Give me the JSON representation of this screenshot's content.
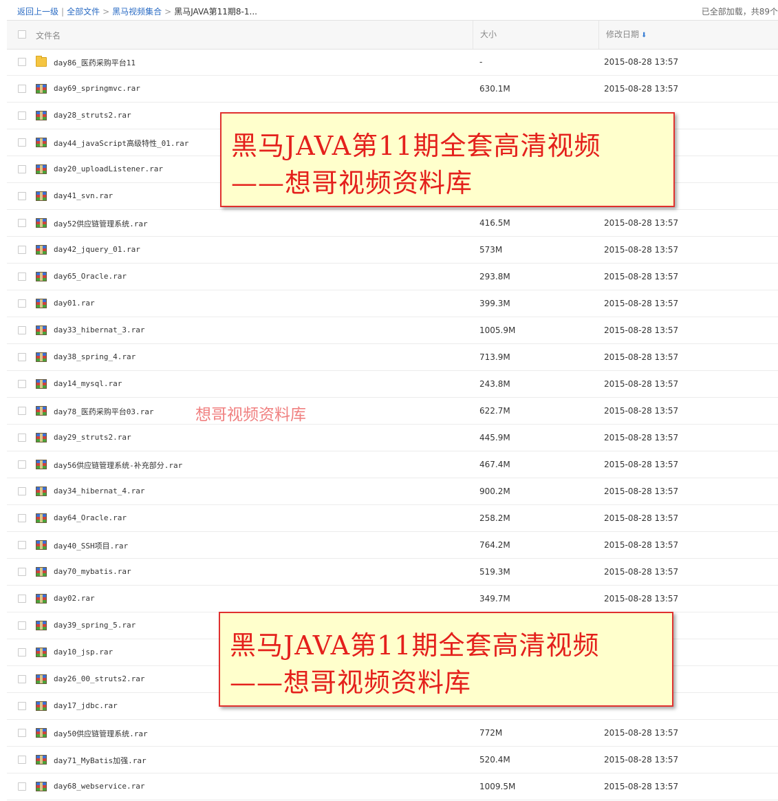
{
  "breadcrumb": {
    "back": "返回上一级",
    "sep1": "|",
    "all_files": "全部文件",
    "sep2": ">",
    "folder": "黑马视频集合",
    "sep3": ">",
    "current": "黑马JAVA第11期8-1..."
  },
  "status": "已全部加载，共89个",
  "header": {
    "name": "文件名",
    "size": "大小",
    "date": "修改日期",
    "sort_icon": "arrow-down-icon"
  },
  "files": [
    {
      "icon": "folder",
      "name": "day86_医药采购平台11",
      "size": "-",
      "date": "2015-08-28 13:57"
    },
    {
      "icon": "rar",
      "name": "day69_springmvc.rar",
      "size": "630.1M",
      "date": "2015-08-28 13:57"
    },
    {
      "icon": "rar",
      "name": "day28_struts2.rar",
      "size": "",
      "date": ""
    },
    {
      "icon": "rar",
      "name": "day44_javaScript高级特性_01.rar",
      "size": "",
      "date": ""
    },
    {
      "icon": "rar",
      "name": "day20_uploadListener.rar",
      "size": "",
      "date": ""
    },
    {
      "icon": "rar",
      "name": "day41_svn.rar",
      "size": "",
      "date": ""
    },
    {
      "icon": "rar",
      "name": "day52供应链管理系统.rar",
      "size": "416.5M",
      "date": "2015-08-28 13:57"
    },
    {
      "icon": "rar",
      "name": "day42_jquery_01.rar",
      "size": "573M",
      "date": "2015-08-28 13:57"
    },
    {
      "icon": "rar",
      "name": "day65_Oracle.rar",
      "size": "293.8M",
      "date": "2015-08-28 13:57"
    },
    {
      "icon": "rar",
      "name": "day01.rar",
      "size": "399.3M",
      "date": "2015-08-28 13:57"
    },
    {
      "icon": "rar",
      "name": "day33_hibernat_3.rar",
      "size": "1005.9M",
      "date": "2015-08-28 13:57"
    },
    {
      "icon": "rar",
      "name": "day38_spring_4.rar",
      "size": "713.9M",
      "date": "2015-08-28 13:57"
    },
    {
      "icon": "rar",
      "name": "day14_mysql.rar",
      "size": "243.8M",
      "date": "2015-08-28 13:57"
    },
    {
      "icon": "rar",
      "name": "day78_医药采购平台03.rar",
      "size": "622.7M",
      "date": "2015-08-28 13:57"
    },
    {
      "icon": "rar",
      "name": "day29_struts2.rar",
      "size": "445.9M",
      "date": "2015-08-28 13:57"
    },
    {
      "icon": "rar",
      "name": "day56供应链管理系统-补充部分.rar",
      "size": "467.4M",
      "date": "2015-08-28 13:57"
    },
    {
      "icon": "rar",
      "name": "day34_hibernat_4.rar",
      "size": "900.2M",
      "date": "2015-08-28 13:57"
    },
    {
      "icon": "rar",
      "name": "day64_Oracle.rar",
      "size": "258.2M",
      "date": "2015-08-28 13:57"
    },
    {
      "icon": "rar",
      "name": "day40_SSH项目.rar",
      "size": "764.2M",
      "date": "2015-08-28 13:57"
    },
    {
      "icon": "rar",
      "name": "day70_mybatis.rar",
      "size": "519.3M",
      "date": "2015-08-28 13:57"
    },
    {
      "icon": "rar",
      "name": "day02.rar",
      "size": "349.7M",
      "date": "2015-08-28 13:57"
    },
    {
      "icon": "rar",
      "name": "day39_spring_5.rar",
      "size": "",
      "date": ""
    },
    {
      "icon": "rar",
      "name": "day10_jsp.rar",
      "size": "",
      "date": ""
    },
    {
      "icon": "rar",
      "name": "day26_00_struts2.rar",
      "size": "",
      "date": ""
    },
    {
      "icon": "rar",
      "name": "day17_jdbc.rar",
      "size": "",
      "date": ""
    },
    {
      "icon": "rar",
      "name": "day50供应链管理系统.rar",
      "size": "772M",
      "date": "2015-08-28 13:57"
    },
    {
      "icon": "rar",
      "name": "day71_MyBatis加强.rar",
      "size": "520.4M",
      "date": "2015-08-28 13:57"
    },
    {
      "icon": "rar",
      "name": "day68_webservice.rar",
      "size": "1009.5M",
      "date": "2015-08-28 13:57"
    }
  ],
  "banners": [
    {
      "line1": "黑马JAVA第11期全套高清视频",
      "line2": "——想哥视频资料库"
    },
    {
      "line1": "黑马JAVA第11期全套高清视频",
      "line2": "——想哥视频资料库"
    }
  ],
  "watermark": "想哥视频资料库"
}
